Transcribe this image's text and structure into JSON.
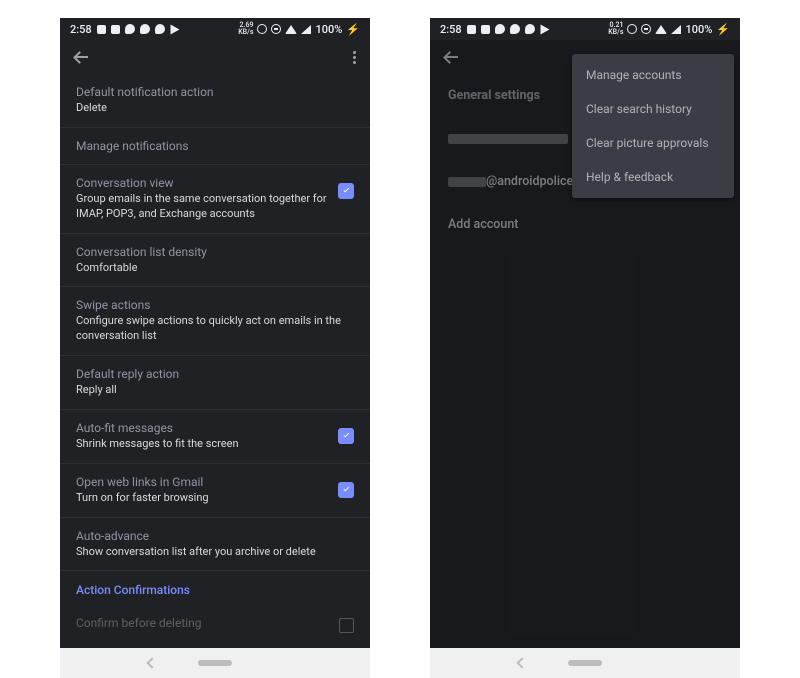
{
  "status": {
    "time": "2:58",
    "net_speed_left": "2.69\nKB/s",
    "net_speed_right": "0.21\nKB/s",
    "battery": "100%"
  },
  "left": {
    "items": [
      {
        "t": "Default notification action",
        "s": "Delete"
      },
      {
        "t": "Manage notifications"
      },
      {
        "t": "Conversation view",
        "s": "Group emails in the same conversation together for IMAP, POP3, and Exchange accounts",
        "chk": true
      },
      {
        "t": "Conversation list density",
        "s": "Comfortable"
      },
      {
        "t": "Swipe actions",
        "s": "Configure swipe actions to quickly act on emails in the conversation list"
      },
      {
        "t": "Default reply action",
        "s": "Reply all"
      },
      {
        "t": "Auto-fit messages",
        "s": "Shrink messages to fit the screen",
        "chk": true
      },
      {
        "t": "Open web links in Gmail",
        "s": "Turn on for faster browsing",
        "chk": true
      },
      {
        "t": "Auto-advance",
        "s": "Show conversation list after you archive or delete"
      }
    ],
    "section": "Action Confirmations",
    "last": {
      "t": "Confirm before deleting"
    }
  },
  "right": {
    "general": "General settings",
    "account_suffix": "@androidpolice.com",
    "add": "Add account",
    "menu": [
      "Manage accounts",
      "Clear search history",
      "Clear picture approvals",
      "Help & feedback"
    ]
  }
}
